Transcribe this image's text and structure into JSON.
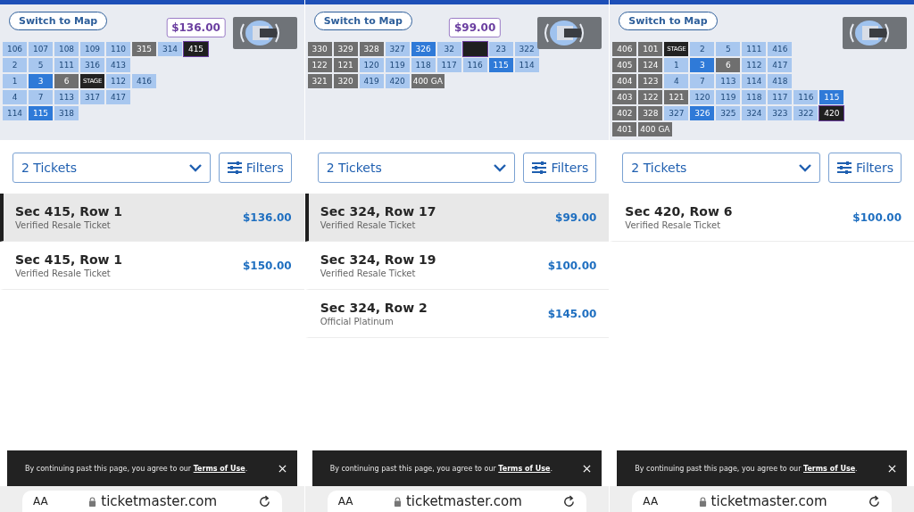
{
  "panels": [
    {
      "map": {
        "switch_button": "Switch to Map",
        "price_tag": "$136.00",
        "rows": [
          [
            {
              "kind": "section",
              "label": "106",
              "color": "#a8c7ef",
              "selected": false
            },
            {
              "kind": "section",
              "label": "107",
              "color": "#a8c7ef",
              "selected": false
            },
            {
              "kind": "section",
              "label": "108",
              "color": "#a8c7ef",
              "selected": false
            },
            {
              "kind": "section",
              "label": "109",
              "color": "#a8c7ef",
              "selected": false
            },
            {
              "kind": "section",
              "label": "110",
              "color": "#a8c7ef",
              "selected": false
            },
            {
              "kind": "section",
              "label": "315",
              "color": "#6f6f6f",
              "selected": false
            },
            {
              "kind": "section",
              "label": "314",
              "color": "#a8c7ef",
              "selected": false
            },
            {
              "kind": "section",
              "label": "415",
              "color": "#1f1f1f",
              "selected": true
            }
          ],
          [
            {
              "kind": "section",
              "label": "2",
              "color": "#a8c7ef",
              "selected": false
            },
            {
              "kind": "section",
              "label": "5",
              "color": "#a8c7ef",
              "selected": false
            },
            {
              "kind": "section",
              "label": "111",
              "color": "#a8c7ef",
              "selected": false
            },
            {
              "kind": "section",
              "label": "316",
              "color": "#a8c7ef",
              "selected": false
            },
            {
              "kind": "section",
              "label": "413",
              "color": "#a8c7ef",
              "selected": false
            }
          ],
          [
            {
              "kind": "section",
              "label": "1",
              "color": "#a8c7ef",
              "selected": false
            },
            {
              "kind": "section",
              "label": "3",
              "color": "#2f7ad8",
              "selected": false
            },
            {
              "kind": "section",
              "label": "6",
              "color": "#6f6f6f",
              "selected": false
            },
            {
              "kind": "stage",
              "label": "STAGE"
            },
            {
              "kind": "section",
              "label": "112",
              "color": "#a8c7ef",
              "selected": false
            },
            {
              "kind": "section",
              "label": "416",
              "color": "#a8c7ef",
              "selected": false
            }
          ],
          [
            {
              "kind": "section",
              "label": "4",
              "color": "#a8c7ef",
              "selected": false
            },
            {
              "kind": "section",
              "label": "7",
              "color": "#a8c7ef",
              "selected": false
            },
            {
              "kind": "section",
              "label": "113",
              "color": "#a8c7ef",
              "selected": false
            },
            {
              "kind": "section",
              "label": "317",
              "color": "#a8c7ef",
              "selected": false
            },
            {
              "kind": "section",
              "label": "417",
              "color": "#a8c7ef",
              "selected": false
            }
          ],
          [
            {
              "kind": "section",
              "label": "114",
              "color": "#a8c7ef",
              "selected": false
            },
            {
              "kind": "section",
              "label": "115",
              "color": "#2f7ad8",
              "selected": false
            },
            {
              "kind": "section",
              "label": "318",
              "color": "#a8c7ef",
              "selected": false
            }
          ]
        ]
      },
      "ticket_select": "2 Tickets",
      "filters_button": "Filters",
      "listings": [
        {
          "section": "Sec 415, Row 1",
          "type": "Verified Resale Ticket",
          "price": "$136.00",
          "selected": true
        },
        {
          "section": "Sec 415, Row 1",
          "type": "Verified Resale Ticket",
          "price": "$150.00",
          "selected": false
        }
      ],
      "notice": {
        "before": "By continuing past this page, you agree to our ",
        "link": "Terms of Use",
        "after": "."
      },
      "browser": {
        "text_size": "AA",
        "url": "ticketmaster.com"
      }
    },
    {
      "map": {
        "switch_button": "Switch to Map",
        "price_tag": "$99.00",
        "rows": [
          [
            {
              "kind": "section",
              "label": "330",
              "color": "#6f6f6f",
              "selected": false
            },
            {
              "kind": "section",
              "label": "329",
              "color": "#6f6f6f",
              "selected": false
            },
            {
              "kind": "section",
              "label": "328",
              "color": "#6f6f6f",
              "selected": false
            },
            {
              "kind": "section",
              "label": "327",
              "color": "#a8c7ef",
              "selected": false
            },
            {
              "kind": "section",
              "label": "326",
              "color": "#2f7ad8",
              "selected": false
            },
            {
              "kind": "section",
              "label": "32",
              "color": "#a8c7ef",
              "selected": false
            },
            {
              "kind": "section",
              "color": "#1f1f1f",
              "selected": true
            },
            {
              "kind": "section",
              "label": "23",
              "color": "#a8c7ef",
              "selected": false
            },
            {
              "kind": "section",
              "label": "322",
              "color": "#a8c7ef",
              "selected": false
            }
          ],
          [
            {
              "kind": "section",
              "label": "122",
              "color": "#6f6f6f",
              "selected": false
            },
            {
              "kind": "section",
              "label": "121",
              "color": "#6f6f6f",
              "selected": false
            },
            {
              "kind": "section",
              "label": "120",
              "color": "#a8c7ef",
              "selected": false
            },
            {
              "kind": "section",
              "label": "119",
              "color": "#a8c7ef",
              "selected": false
            },
            {
              "kind": "section",
              "label": "118",
              "color": "#a8c7ef",
              "selected": false
            },
            {
              "kind": "section",
              "label": "117",
              "color": "#a8c7ef",
              "selected": false
            },
            {
              "kind": "section",
              "label": "116",
              "color": "#a8c7ef",
              "selected": false
            },
            {
              "kind": "section",
              "label": "115",
              "color": "#2f7ad8",
              "selected": false
            },
            {
              "kind": "section",
              "label": "114",
              "color": "#a8c7ef",
              "selected": false
            }
          ],
          [
            {
              "kind": "section",
              "label": "321",
              "color": "#6f6f6f",
              "selected": false
            },
            {
              "kind": "section",
              "label": "320",
              "color": "#6f6f6f",
              "selected": false
            },
            {
              "kind": "section",
              "label": "419",
              "color": "#a8c7ef",
              "selected": false
            },
            {
              "kind": "section",
              "label": "420",
              "color": "#a8c7ef",
              "selected": false
            },
            {
              "kind": "section",
              "label": "400 GA",
              "color": "#6f6f6f",
              "selected": false
            }
          ]
        ]
      },
      "ticket_select": "2 Tickets",
      "filters_button": "Filters",
      "listings": [
        {
          "section": "Sec 324, Row 17",
          "type": "Verified Resale Ticket",
          "price": "$99.00",
          "selected": true
        },
        {
          "section": "Sec 324, Row 19",
          "type": "Verified Resale Ticket",
          "price": "$100.00",
          "selected": false
        },
        {
          "section": "Sec 324, Row 2",
          "type": "Official Platinum",
          "price": "$145.00",
          "selected": false
        }
      ],
      "notice": {
        "before": "By continuing past this page, you agree to our ",
        "link": "Terms of Use",
        "after": "."
      },
      "browser": {
        "text_size": "AA",
        "url": "ticketmaster.com"
      }
    },
    {
      "map": {
        "switch_button": "Switch to Map",
        "rows": [
          [
            {
              "kind": "section",
              "label": "406",
              "color": "#6f6f6f",
              "selected": false
            },
            {
              "kind": "section",
              "label": "101",
              "color": "#6f6f6f",
              "selected": false
            },
            {
              "kind": "stage",
              "label": "STAGE"
            },
            {
              "kind": "section",
              "label": "2",
              "color": "#a8c7ef",
              "selected": false
            },
            {
              "kind": "section",
              "label": "5",
              "color": "#a8c7ef",
              "selected": false
            },
            {
              "kind": "section",
              "label": "111",
              "color": "#a8c7ef",
              "selected": false
            },
            {
              "kind": "section",
              "label": "416",
              "color": "#a8c7ef",
              "selected": false
            }
          ],
          [
            {
              "kind": "section",
              "label": "405",
              "color": "#6f6f6f",
              "selected": false
            },
            {
              "kind": "section",
              "label": "124",
              "color": "#6f6f6f",
              "selected": false
            },
            {
              "kind": "section",
              "label": "1",
              "color": "#a8c7ef",
              "selected": false
            },
            {
              "kind": "section",
              "label": "3",
              "color": "#2f7ad8",
              "selected": false
            },
            {
              "kind": "section",
              "label": "6",
              "color": "#6f6f6f",
              "selected": false
            },
            {
              "kind": "section",
              "label": "112",
              "color": "#a8c7ef",
              "selected": false
            },
            {
              "kind": "section",
              "label": "417",
              "color": "#a8c7ef",
              "selected": false
            }
          ],
          [
            {
              "kind": "section",
              "label": "404",
              "color": "#6f6f6f",
              "selected": false
            },
            {
              "kind": "section",
              "label": "123",
              "color": "#6f6f6f",
              "selected": false
            },
            {
              "kind": "section",
              "label": "4",
              "color": "#a8c7ef",
              "selected": false
            },
            {
              "kind": "section",
              "label": "7",
              "color": "#a8c7ef",
              "selected": false
            },
            {
              "kind": "section",
              "label": "113",
              "color": "#a8c7ef",
              "selected": false
            },
            {
              "kind": "section",
              "label": "114",
              "color": "#a8c7ef",
              "selected": false
            },
            {
              "kind": "section",
              "label": "418",
              "color": "#a8c7ef",
              "selected": false
            }
          ],
          [
            {
              "kind": "section",
              "label": "403",
              "color": "#6f6f6f",
              "selected": false
            },
            {
              "kind": "section",
              "label": "122",
              "color": "#6f6f6f",
              "selected": false
            },
            {
              "kind": "section",
              "label": "121",
              "color": "#6f6f6f",
              "selected": false
            },
            {
              "kind": "section",
              "label": "120",
              "color": "#a8c7ef",
              "selected": false
            },
            {
              "kind": "section",
              "label": "119",
              "color": "#a8c7ef",
              "selected": false
            },
            {
              "kind": "section",
              "label": "118",
              "color": "#a8c7ef",
              "selected": false
            },
            {
              "kind": "section",
              "label": "117",
              "color": "#a8c7ef",
              "selected": false
            },
            {
              "kind": "section",
              "label": "116",
              "color": "#a8c7ef",
              "selected": false
            },
            {
              "kind": "section",
              "label": "115",
              "color": "#2f7ad8",
              "selected": false
            }
          ],
          [
            {
              "kind": "section",
              "label": "402",
              "color": "#6f6f6f",
              "selected": false
            },
            {
              "kind": "section",
              "label": "328",
              "color": "#6f6f6f",
              "selected": false
            },
            {
              "kind": "section",
              "label": "327",
              "color": "#a8c7ef",
              "selected": false
            },
            {
              "kind": "section",
              "label": "326",
              "color": "#2f7ad8",
              "selected": false
            },
            {
              "kind": "section",
              "label": "325",
              "color": "#a8c7ef",
              "selected": false
            },
            {
              "kind": "section",
              "label": "324",
              "color": "#a8c7ef",
              "selected": false
            },
            {
              "kind": "section",
              "label": "323",
              "color": "#a8c7ef",
              "selected": false
            },
            {
              "kind": "section",
              "label": "322",
              "color": "#a8c7ef",
              "selected": false
            },
            {
              "kind": "section",
              "label": "420",
              "color": "#1f1f1f",
              "selected": true
            }
          ],
          [
            {
              "kind": "section",
              "label": "401",
              "color": "#6f6f6f",
              "selected": false
            },
            {
              "kind": "section",
              "label": "400 GA",
              "color": "#6f6f6f",
              "selected": false
            }
          ]
        ]
      },
      "ticket_select": "2 Tickets",
      "filters_button": "Filters",
      "listings": [
        {
          "section": "Sec 420, Row 6",
          "type": "Verified Resale Ticket",
          "price": "$100.00",
          "selected": false
        }
      ],
      "notice": {
        "before": "By continuing past this page, you agree to our ",
        "link": "Terms of Use",
        "after": "."
      },
      "browser": {
        "text_size": "AA",
        "url": "ticketmaster.com"
      }
    }
  ]
}
